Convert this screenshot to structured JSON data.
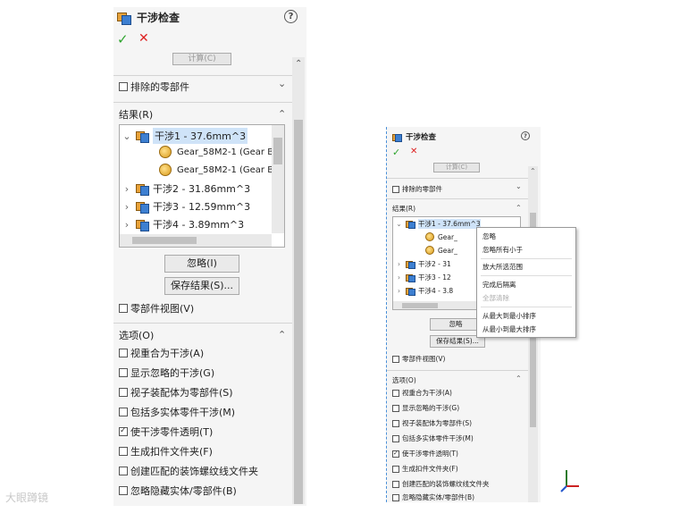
{
  "panel": {
    "title": "干涉检查",
    "help": "?",
    "ok": "✓",
    "cancel": "✕",
    "calc_label": "计算(C)",
    "excluded_label": "排除的零部件",
    "results_label": "结果(R)",
    "results": [
      {
        "label": "干涉1 - 37.6mm^3",
        "expanded": true
      },
      {
        "label": "Gear_58M2-1 (Gear Bl"
      },
      {
        "label": "Gear_58M2-1 (Gear Bl"
      },
      {
        "label": "干涉2 - 31.86mm^3"
      },
      {
        "label": "干涉3 - 12.59mm^3"
      },
      {
        "label": "干涉4 - 3.89mm^3"
      }
    ],
    "ignore_label": "忽略(I)",
    "save_label": "保存结果(S)...",
    "part_view_label": "零部件视图(V)",
    "options_label": "选项(O)",
    "options": [
      {
        "label": "视重合为干涉(A)",
        "checked": false
      },
      {
        "label": "显示忽略的干涉(G)",
        "checked": false
      },
      {
        "label": "视子装配体为零部件(S)",
        "checked": false
      },
      {
        "label": "包括多实体零件干涉(M)",
        "checked": false
      },
      {
        "label": "使干涉零件透明(T)",
        "checked": true
      },
      {
        "label": "生成扣件文件夹(F)",
        "checked": false
      },
      {
        "label": "创建匹配的装饰螺纹线文件夹",
        "checked": false
      },
      {
        "label": "忽略隐藏实体/零部件(B)",
        "checked": false
      }
    ]
  },
  "small": {
    "results": [
      {
        "label": "干涉1 - 37.6mm^3"
      },
      {
        "label": "Gear_"
      },
      {
        "label": "Gear_"
      },
      {
        "label": "干涉2 - 31"
      },
      {
        "label": "干涉3 - 12"
      },
      {
        "label": "干涉4 - 3.8"
      }
    ],
    "ignore_label": "忽略"
  },
  "context_menu": [
    {
      "label": "忽略",
      "disabled": false
    },
    {
      "label": "忽略所有小于",
      "disabled": false
    },
    {
      "label": "放大所选范围",
      "disabled": false
    },
    {
      "label": "完成后隔离",
      "disabled": false
    },
    {
      "label": "全部清除",
      "disabled": true
    },
    {
      "label": "从最大到最小排序",
      "disabled": false
    },
    {
      "label": "从最小到最大排序",
      "disabled": false
    }
  ],
  "watermark": "大眼蹲镜"
}
